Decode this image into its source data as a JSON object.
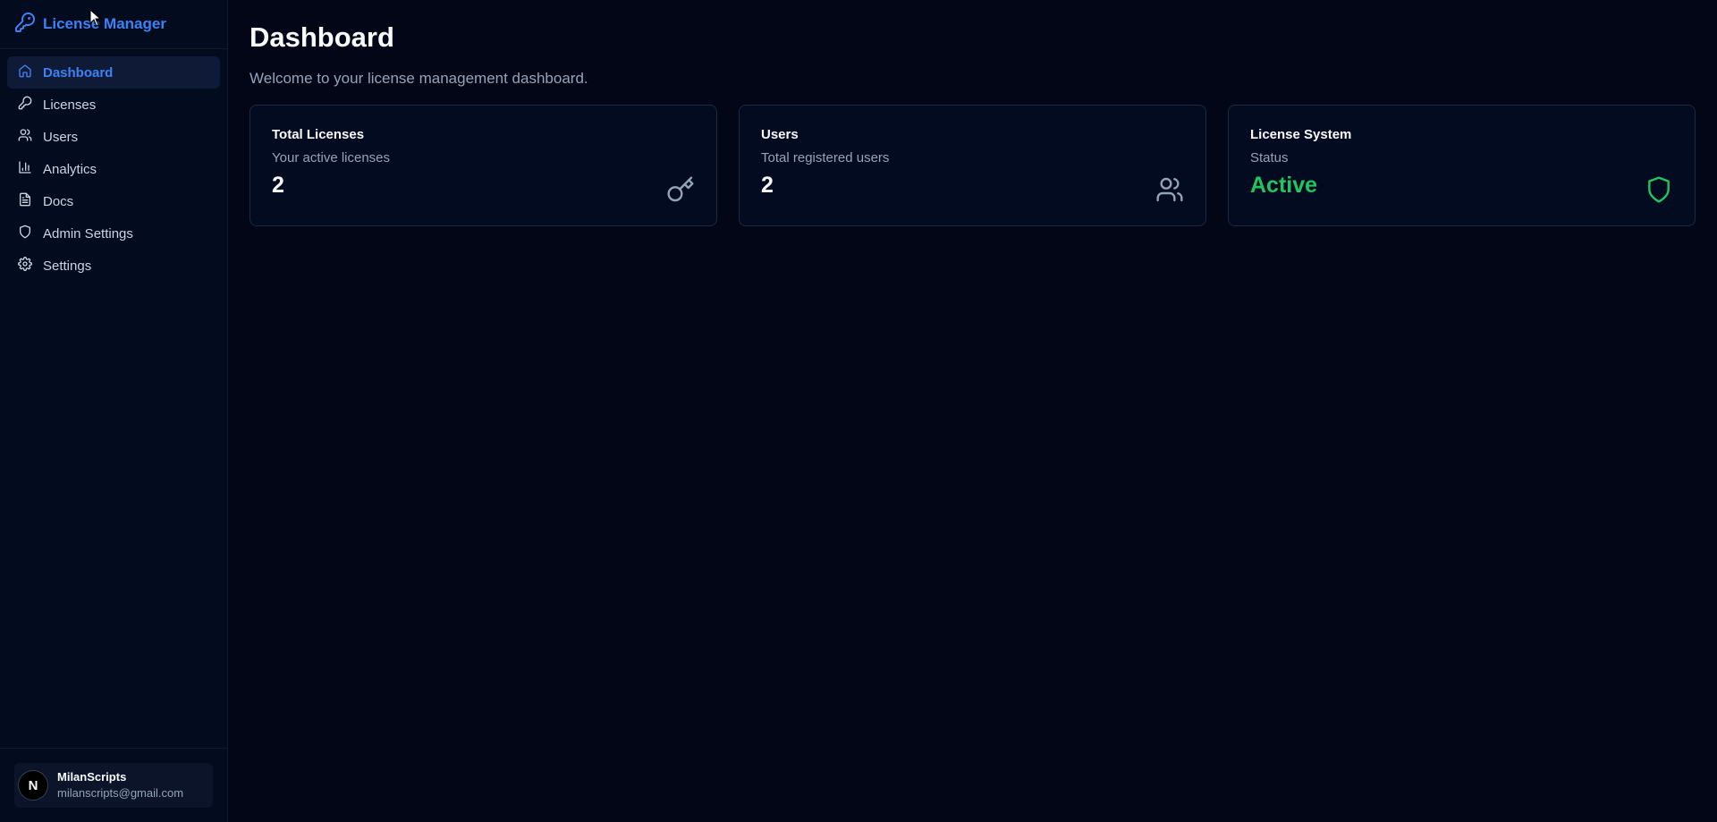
{
  "brand": {
    "name": "License Manager",
    "icon": "key-icon",
    "color": "#3b82f6"
  },
  "nav": {
    "items": [
      {
        "label": "Dashboard",
        "icon": "home-icon",
        "active": true
      },
      {
        "label": "Licenses",
        "icon": "key-icon",
        "active": false
      },
      {
        "label": "Users",
        "icon": "users-icon",
        "active": false
      },
      {
        "label": "Analytics",
        "icon": "bar-chart-icon",
        "active": false
      },
      {
        "label": "Docs",
        "icon": "file-text-icon",
        "active": false
      },
      {
        "label": "Admin Settings",
        "icon": "shield-icon",
        "active": false
      },
      {
        "label": "Settings",
        "icon": "gear-icon",
        "active": false
      }
    ]
  },
  "user": {
    "avatar_letter": "N",
    "name": "MilanScripts",
    "email": "milanscripts@gmail.com"
  },
  "main": {
    "title": "Dashboard",
    "subtitle": "Welcome to your license management dashboard.",
    "cards": [
      {
        "title": "Total Licenses",
        "description": "Your active licenses",
        "value": "2",
        "icon": "key-icon"
      },
      {
        "title": "Users",
        "description": "Total registered users",
        "value": "2",
        "icon": "users-icon"
      },
      {
        "title": "License System",
        "description": "Status",
        "value": "Active",
        "icon": "shield-icon",
        "value_color": "#22c55e"
      }
    ]
  }
}
